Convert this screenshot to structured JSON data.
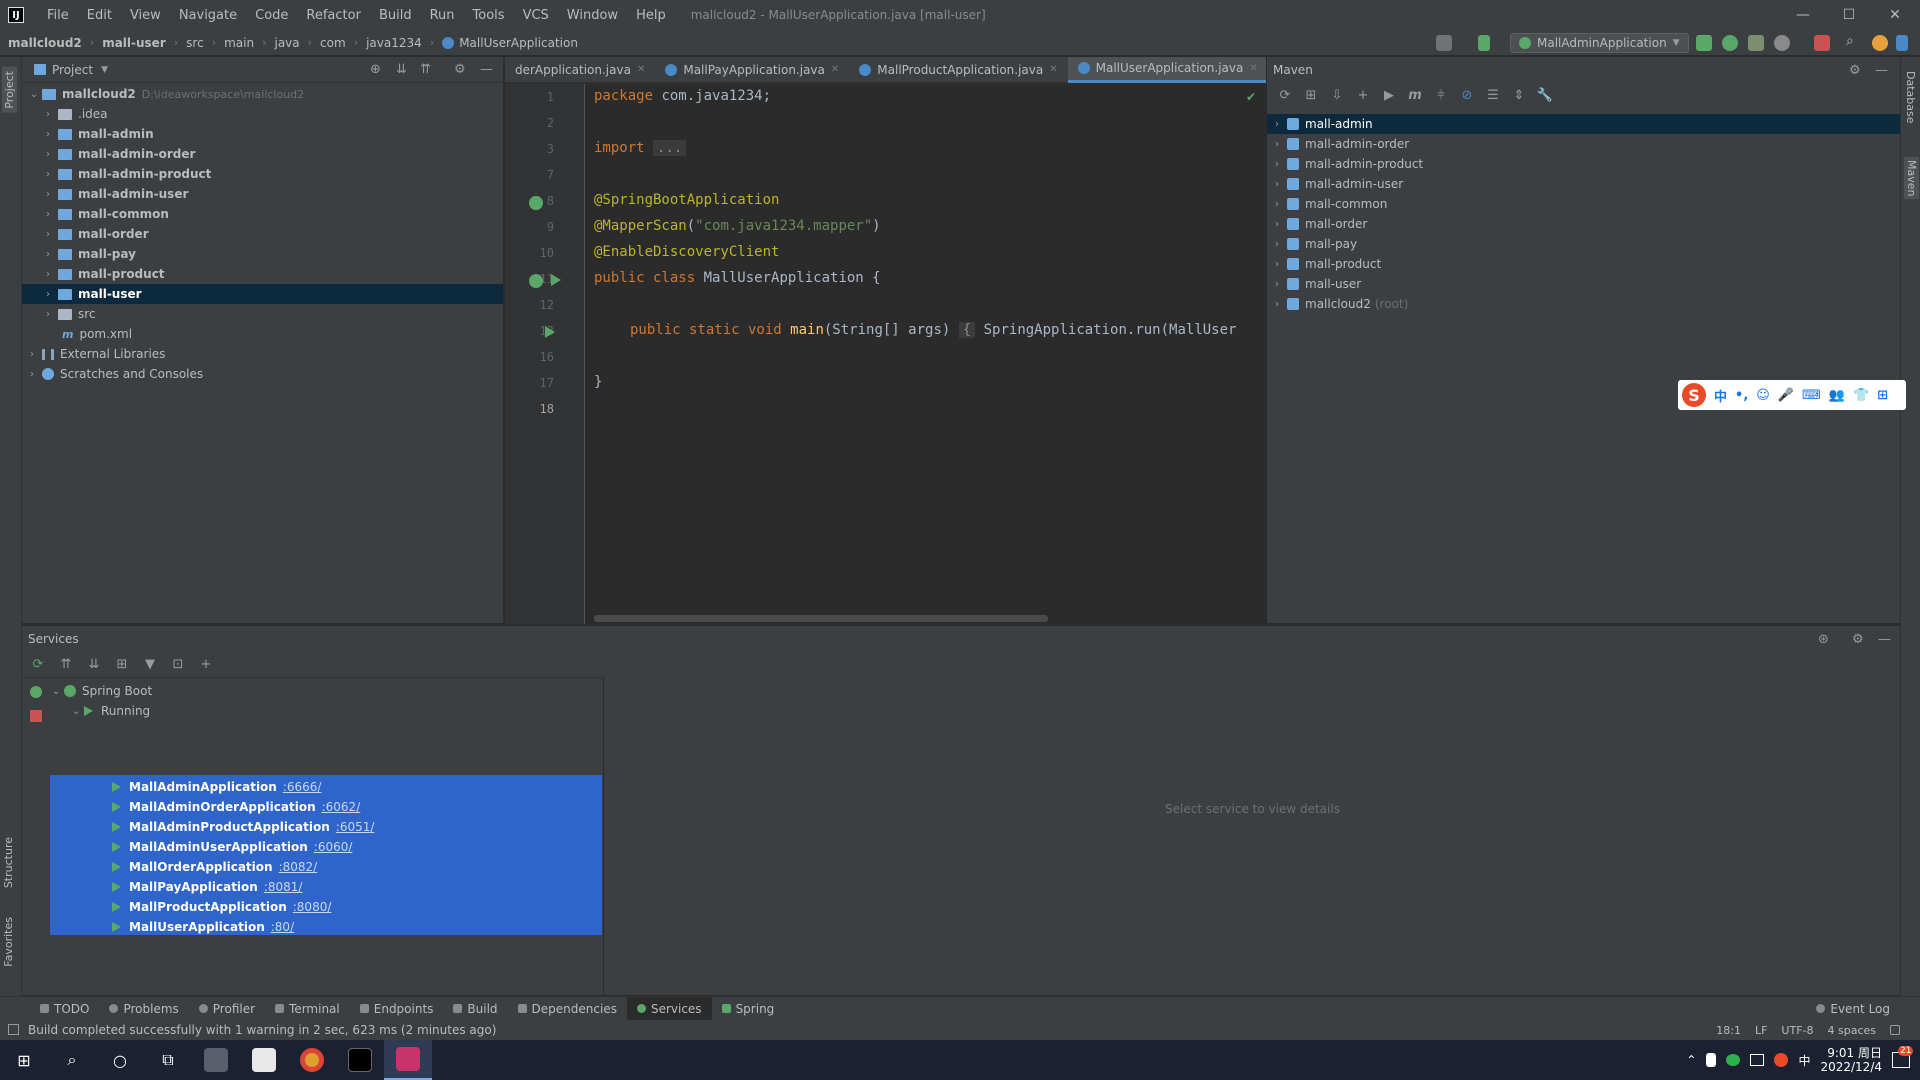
{
  "titlebar": {
    "logo": "IJ",
    "menu": [
      "File",
      "Edit",
      "View",
      "Navigate",
      "Code",
      "Refactor",
      "Build",
      "Run",
      "Tools",
      "VCS",
      "Window",
      "Help"
    ],
    "title": "mallcloud2 - MallUserApplication.java [mall-user]",
    "controls": [
      "—",
      "☐",
      "✕"
    ]
  },
  "navbar": {
    "crumbs": [
      "mallcloud2",
      "mall-user",
      "src",
      "main",
      "java",
      "com",
      "java1234",
      "MallUserApplication"
    ],
    "run_config": "MallAdminApplication"
  },
  "left_strip": {
    "tabs": [
      "Project",
      "Structure",
      "Favorites"
    ]
  },
  "right_strip": {
    "tabs": [
      "Database",
      "Maven"
    ]
  },
  "project": {
    "header": "Project",
    "root": {
      "name": "mallcloud2",
      "path": "D:\\ideaworkspace\\mallcloud2"
    },
    "items": [
      ".idea",
      "mall-admin",
      "mall-admin-order",
      "mall-admin-product",
      "mall-admin-user",
      "mall-common",
      "mall-order",
      "mall-pay",
      "mall-product",
      "mall-user",
      "src",
      "pom.xml"
    ],
    "external": "External Libraries",
    "scratches": "Scratches and Consoles"
  },
  "editor": {
    "tabs": [
      {
        "label": "derApplication.java",
        "active": false
      },
      {
        "label": "MallPayApplication.java",
        "active": false
      },
      {
        "label": "MallProductApplication.java",
        "active": false
      },
      {
        "label": "MallUserApplication.java",
        "active": true
      }
    ],
    "line_numbers": [
      "1",
      "2",
      "3",
      "7",
      "8",
      "9",
      "10",
      "11",
      "12",
      "13",
      "16",
      "17",
      "18"
    ],
    "code": {
      "l1_kw": "package",
      "l1_rest": " com.java1234;",
      "l3_kw": "import",
      "l3_fold": "...",
      "l8": "@SpringBootApplication",
      "l9_ann": "@MapperScan",
      "l9_open": "(",
      "l9_str": "\"com.java1234.mapper\"",
      "l9_close": ")",
      "l10": "@EnableDiscoveryClient",
      "l11_kw": "public class",
      "l11_rest": " MallUserApplication {",
      "l13_kw": "public static void",
      "l13_fn": "main",
      "l13_args": "(String[] args) ",
      "l13_fold": "{",
      "l13_rest": " SpringApplication.run(MallUser",
      "l17": "}"
    }
  },
  "maven": {
    "header": "Maven",
    "toolbar": [
      "⟳",
      "⊞",
      "⇩",
      "+",
      "▶",
      "m",
      "⫩",
      "⊘",
      "☰",
      "⇕",
      "🔧"
    ],
    "items": [
      "mall-admin",
      "mall-admin-order",
      "mall-admin-product",
      "mall-admin-user",
      "mall-common",
      "mall-order",
      "mall-pay",
      "mall-product",
      "mall-user"
    ],
    "root_item": "mallcloud2",
    "root_tag": "(root)"
  },
  "ime": {
    "logo": "S",
    "items": [
      "中",
      "•,",
      "☺",
      "🎤",
      "⌨",
      "👥",
      "👕",
      "⊞"
    ]
  },
  "services": {
    "header": "Services",
    "toolbar": [
      "⟳",
      "⇈",
      "⇊",
      "⊞",
      "▼",
      "⊡",
      "+"
    ],
    "group": "Spring Boot",
    "running": "Running",
    "apps": [
      {
        "name": "MallAdminApplication",
        "port": ":6666/"
      },
      {
        "name": "MallAdminOrderApplication",
        "port": ":6062/"
      },
      {
        "name": "MallAdminProductApplication",
        "port": ":6051/"
      },
      {
        "name": "MallAdminUserApplication",
        "port": ":6060/"
      },
      {
        "name": "MallOrderApplication",
        "port": ":8082/"
      },
      {
        "name": "MallPayApplication",
        "port": ":8081/"
      },
      {
        "name": "MallProductApplication",
        "port": ":8080/"
      },
      {
        "name": "MallUserApplication",
        "port": ":80/"
      }
    ],
    "detail_placeholder": "Select service to view details"
  },
  "tool_tabs": [
    {
      "label": "TODO",
      "active": false
    },
    {
      "label": "Problems",
      "active": false
    },
    {
      "label": "Profiler",
      "active": false
    },
    {
      "label": "Terminal",
      "active": false
    },
    {
      "label": "Endpoints",
      "active": false
    },
    {
      "label": "Build",
      "active": false
    },
    {
      "label": "Dependencies",
      "active": false
    },
    {
      "label": "Services",
      "active": true
    },
    {
      "label": "Spring",
      "active": false
    }
  ],
  "event_log": "Event Log",
  "status": {
    "message": "Build completed successfully with 1 warning in 2 sec, 623 ms (2 minutes ago)",
    "right": [
      "18:1",
      "LF",
      "UTF-8",
      "4 spaces"
    ]
  },
  "taskbar": {
    "time": "9:01 周日",
    "date": "2022/12/4",
    "tray_lang": "中",
    "notification_count": "21"
  },
  "colors": {
    "accent": "#4a88c7",
    "selection": "#2f65ca",
    "keyword": "#cc7832",
    "annotation": "#bbb529",
    "string": "#6a8759",
    "run_green": "#59a869"
  }
}
